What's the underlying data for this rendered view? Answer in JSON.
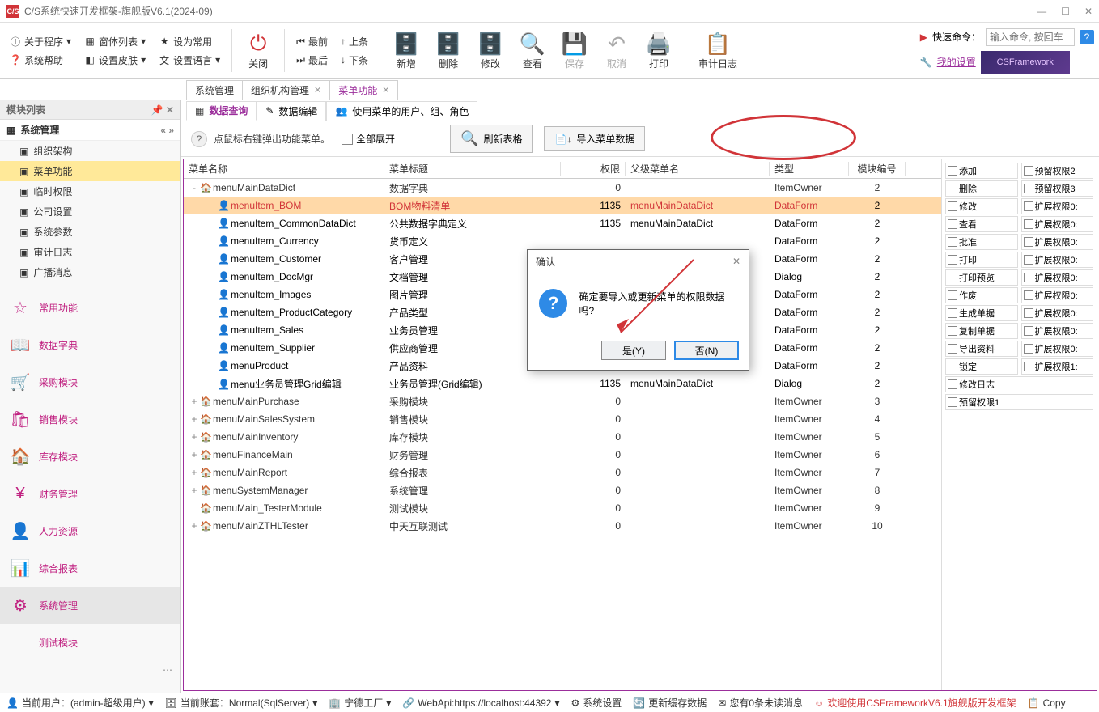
{
  "title": "C/S系统快速开发框架-旗舰版V6.1(2024-09)",
  "menuSmall": {
    "about": "关于程序",
    "formList": "窗体列表",
    "setCommon": "设为常用",
    "sysHelp": "系统帮助",
    "setSkin": "设置皮肤",
    "setLang": "设置语言"
  },
  "menuNav": {
    "first": "最前",
    "prev": "上条",
    "last": "最后",
    "next": "下条"
  },
  "menuBig": {
    "close": "关闭",
    "add": "新增",
    "delete": "删除",
    "modify": "修改",
    "view": "查看",
    "save": "保存",
    "cancel": "取消",
    "print": "打印",
    "audit": "审计日志"
  },
  "quickCmd": {
    "label": "快速命令：",
    "placeholder": "输入命令, 按回车",
    "settings": "我的设置",
    "promo": "CSFramework"
  },
  "sideHead": "模块列表",
  "sideCat": "系统管理",
  "sideItems": [
    "组织架构",
    "菜单功能",
    "临时权限",
    "公司设置",
    "系统参数",
    "审计日志",
    "广播消息"
  ],
  "sideMods": [
    "常用功能",
    "数据字典",
    "采购模块",
    "销售模块",
    "库存模块",
    "财务管理",
    "人力资源",
    "综合报表",
    "系统管理",
    "测试模块"
  ],
  "tabs": [
    "系统管理",
    "组织机构管理",
    "菜单功能"
  ],
  "subtabs": [
    "数据查询",
    "数据编辑",
    "使用菜单的用户、组、角色"
  ],
  "action": {
    "hint": "点鼠标右键弹出功能菜单。",
    "expand": "全部展开",
    "refresh": "刷新表格",
    "import": "导入菜单数据"
  },
  "gridCols": [
    "菜单名称",
    "菜单标题",
    "权限",
    "父级菜单名",
    "类型",
    "模块编号"
  ],
  "rows": [
    {
      "lvl": 0,
      "exp": "-",
      "name": "menuMainDataDict",
      "title": "数据字典",
      "perm": "0",
      "parent": "",
      "type": "ItemOwner",
      "seq": "2"
    },
    {
      "lvl": 1,
      "hl": true,
      "name": "menuItem_BOM",
      "title": "BOM物料清单",
      "perm": "1135",
      "parent": "menuMainDataDict",
      "type": "DataForm",
      "seq": "2"
    },
    {
      "lvl": 1,
      "name": "menuItem_CommonDataDict",
      "title": "公共数据字典定义",
      "perm": "1135",
      "parent": "menuMainDataDict",
      "type": "DataForm",
      "seq": "2"
    },
    {
      "lvl": 1,
      "name": "menuItem_Currency",
      "title": "货币定义",
      "perm": "",
      "parent": "",
      "type": "DataForm",
      "seq": "2"
    },
    {
      "lvl": 1,
      "name": "menuItem_Customer",
      "title": "客户管理",
      "perm": "",
      "parent": "",
      "type": "DataForm",
      "seq": "2"
    },
    {
      "lvl": 1,
      "name": "menuItem_DocMgr",
      "title": "文档管理",
      "perm": "",
      "parent": "",
      "type": "Dialog",
      "seq": "2"
    },
    {
      "lvl": 1,
      "name": "menuItem_Images",
      "title": "图片管理",
      "perm": "",
      "parent": "",
      "type": "DataForm",
      "seq": "2"
    },
    {
      "lvl": 1,
      "name": "menuItem_ProductCategory",
      "title": "产品类型",
      "perm": "",
      "parent": "",
      "type": "DataForm",
      "seq": "2"
    },
    {
      "lvl": 1,
      "name": "menuItem_Sales",
      "title": "业务员管理",
      "perm": "",
      "parent": "",
      "type": "DataForm",
      "seq": "2"
    },
    {
      "lvl": 1,
      "name": "menuItem_Supplier",
      "title": "供应商管理",
      "perm": "",
      "parent": "",
      "type": "DataForm",
      "seq": "2"
    },
    {
      "lvl": 1,
      "name": "menuProduct",
      "title": "产品资料",
      "perm": "",
      "parent": "menuMainDataDict",
      "type": "DataForm",
      "seq": "2"
    },
    {
      "lvl": 1,
      "name": "menu业务员管理Grid编辑",
      "title": "业务员管理(Grid编辑)",
      "perm": "1135",
      "parent": "menuMainDataDict",
      "type": "Dialog",
      "seq": "2"
    },
    {
      "lvl": 0,
      "exp": "+",
      "name": "menuMainPurchase",
      "title": "采购模块",
      "perm": "0",
      "parent": "",
      "type": "ItemOwner",
      "seq": "3"
    },
    {
      "lvl": 0,
      "exp": "+",
      "name": "menuMainSalesSystem",
      "title": "销售模块",
      "perm": "0",
      "parent": "",
      "type": "ItemOwner",
      "seq": "4"
    },
    {
      "lvl": 0,
      "exp": "+",
      "name": "menuMainInventory",
      "title": "库存模块",
      "perm": "0",
      "parent": "",
      "type": "ItemOwner",
      "seq": "5"
    },
    {
      "lvl": 0,
      "exp": "+",
      "name": "menuFinanceMain",
      "title": "财务管理",
      "perm": "0",
      "parent": "",
      "type": "ItemOwner",
      "seq": "6"
    },
    {
      "lvl": 0,
      "exp": "+",
      "name": "menuMainReport",
      "title": "综合报表",
      "perm": "0",
      "parent": "",
      "type": "ItemOwner",
      "seq": "7"
    },
    {
      "lvl": 0,
      "exp": "+",
      "name": "menuSystemManager",
      "title": "系统管理",
      "perm": "0",
      "parent": "",
      "type": "ItemOwner",
      "seq": "8"
    },
    {
      "lvl": 0,
      "exp": " ",
      "name": "menuMain_TesterModule",
      "title": "测试模块",
      "perm": "0",
      "parent": "",
      "type": "ItemOwner",
      "seq": "9"
    },
    {
      "lvl": 0,
      "exp": "+",
      "name": "menuMainZTHLTester",
      "title": "中天互联测试",
      "perm": "0",
      "parent": "",
      "type": "ItemOwner",
      "seq": "10"
    }
  ],
  "perms": [
    [
      "添加",
      "预留权限2"
    ],
    [
      "删除",
      "预留权限3"
    ],
    [
      "修改",
      "扩展权限0:"
    ],
    [
      "查看",
      "扩展权限0:"
    ],
    [
      "批准",
      "扩展权限0:"
    ],
    [
      "打印",
      "扩展权限0:"
    ],
    [
      "打印预览",
      "扩展权限0:"
    ],
    [
      "作废",
      "扩展权限0:"
    ],
    [
      "生成单据",
      "扩展权限0:"
    ],
    [
      "复制单据",
      "扩展权限0:"
    ],
    [
      "导出资料",
      "扩展权限0:"
    ],
    [
      "锁定",
      "扩展权限1:"
    ],
    [
      "修改日志",
      ""
    ],
    [
      "预留权限1",
      ""
    ]
  ],
  "dialog": {
    "title": "确认",
    "msg": "确定要导入或更新菜单的权限数据吗?",
    "yes": "是(Y)",
    "no": "否(N)"
  },
  "status": {
    "user": "当前用户：(admin-超级用户)",
    "account": "当前账套：Normal(SqlServer)",
    "factory": "宁德工厂",
    "webapi": "WebApi:https://localhost:44392",
    "sysset": "系统设置",
    "refresh": "更新缓存数据",
    "msg": "您有0条未读消息",
    "welcome": "欢迎使用CSFrameworkV6.1旗舰版开发框架",
    "copy": "Copy"
  }
}
